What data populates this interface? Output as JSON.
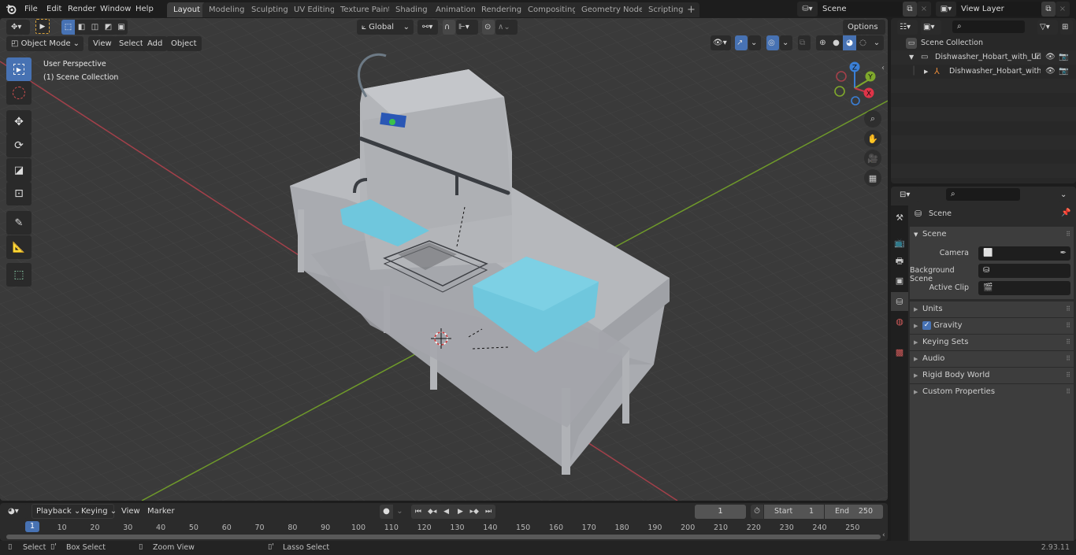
{
  "topbar": {
    "menus": [
      "File",
      "Edit",
      "Render",
      "Window",
      "Help"
    ],
    "workspaces": [
      "Layout",
      "Modeling",
      "Sculpting",
      "UV Editing",
      "Texture Paint",
      "Shading",
      "Animation",
      "Rendering",
      "Compositing",
      "Geometry Nodes",
      "Scripting"
    ],
    "active_workspace": "Layout",
    "add_tab": "+",
    "scene_name": "Scene",
    "view_layer": "View Layer"
  },
  "viewport": {
    "mode": "Object Mode",
    "menus": [
      "View",
      "Select",
      "Add",
      "Object"
    ],
    "orientation": "Global",
    "options_label": "Options",
    "overlay_title": "User Perspective",
    "overlay_collection": "(1) Scene Collection",
    "gizmo_axes": {
      "x": "X",
      "y": "Y",
      "z": "Z"
    },
    "colors": {
      "x_axis": "#c4394a",
      "y_axis": "#7fa82c",
      "z_axis": "#3a7fd6",
      "accent": "#4772b3",
      "tray": "#6fc7dd"
    }
  },
  "toolbar": {
    "tools": [
      "select-box",
      "cursor",
      "move",
      "rotate",
      "scale",
      "transform",
      "annotate",
      "measure",
      "add-cube"
    ]
  },
  "outliner": {
    "search_placeholder": "",
    "root": "Scene Collection",
    "items": [
      {
        "label": "Dishwasher_Hobart_with_Unk",
        "type": "collection",
        "expanded": true,
        "checked": true
      },
      {
        "label": "Dishwasher_Hobart_with",
        "type": "empty",
        "expanded": false
      }
    ]
  },
  "properties": {
    "header": "Scene",
    "section": "Scene",
    "fields": [
      {
        "label": "Camera",
        "value": ""
      },
      {
        "label": "Background Scene",
        "value": ""
      },
      {
        "label": "Active Clip",
        "value": ""
      }
    ],
    "panels": [
      {
        "label": "Units",
        "checkbox": false
      },
      {
        "label": "Gravity",
        "checkbox": true,
        "checked": true
      },
      {
        "label": "Keying Sets",
        "checkbox": false
      },
      {
        "label": "Audio",
        "checkbox": false
      },
      {
        "label": "Rigid Body World",
        "checkbox": false
      },
      {
        "label": "Custom Properties",
        "checkbox": false
      }
    ]
  },
  "timeline": {
    "menus": [
      "Playback",
      "Keying",
      "View",
      "Marker"
    ],
    "current_frame": "1",
    "start_label": "Start",
    "start": "1",
    "end_label": "End",
    "end": "250",
    "ticks": [
      "10",
      "20",
      "30",
      "40",
      "50",
      "60",
      "70",
      "80",
      "90",
      "100",
      "110",
      "120",
      "130",
      "140",
      "150",
      "160",
      "170",
      "180",
      "190",
      "200",
      "210",
      "220",
      "230",
      "240",
      "250"
    ],
    "playhead": "1"
  },
  "statusbar": {
    "hints": [
      "Select",
      "Box Select",
      "Zoom View",
      "Lasso Select"
    ],
    "version": "2.93.11"
  }
}
